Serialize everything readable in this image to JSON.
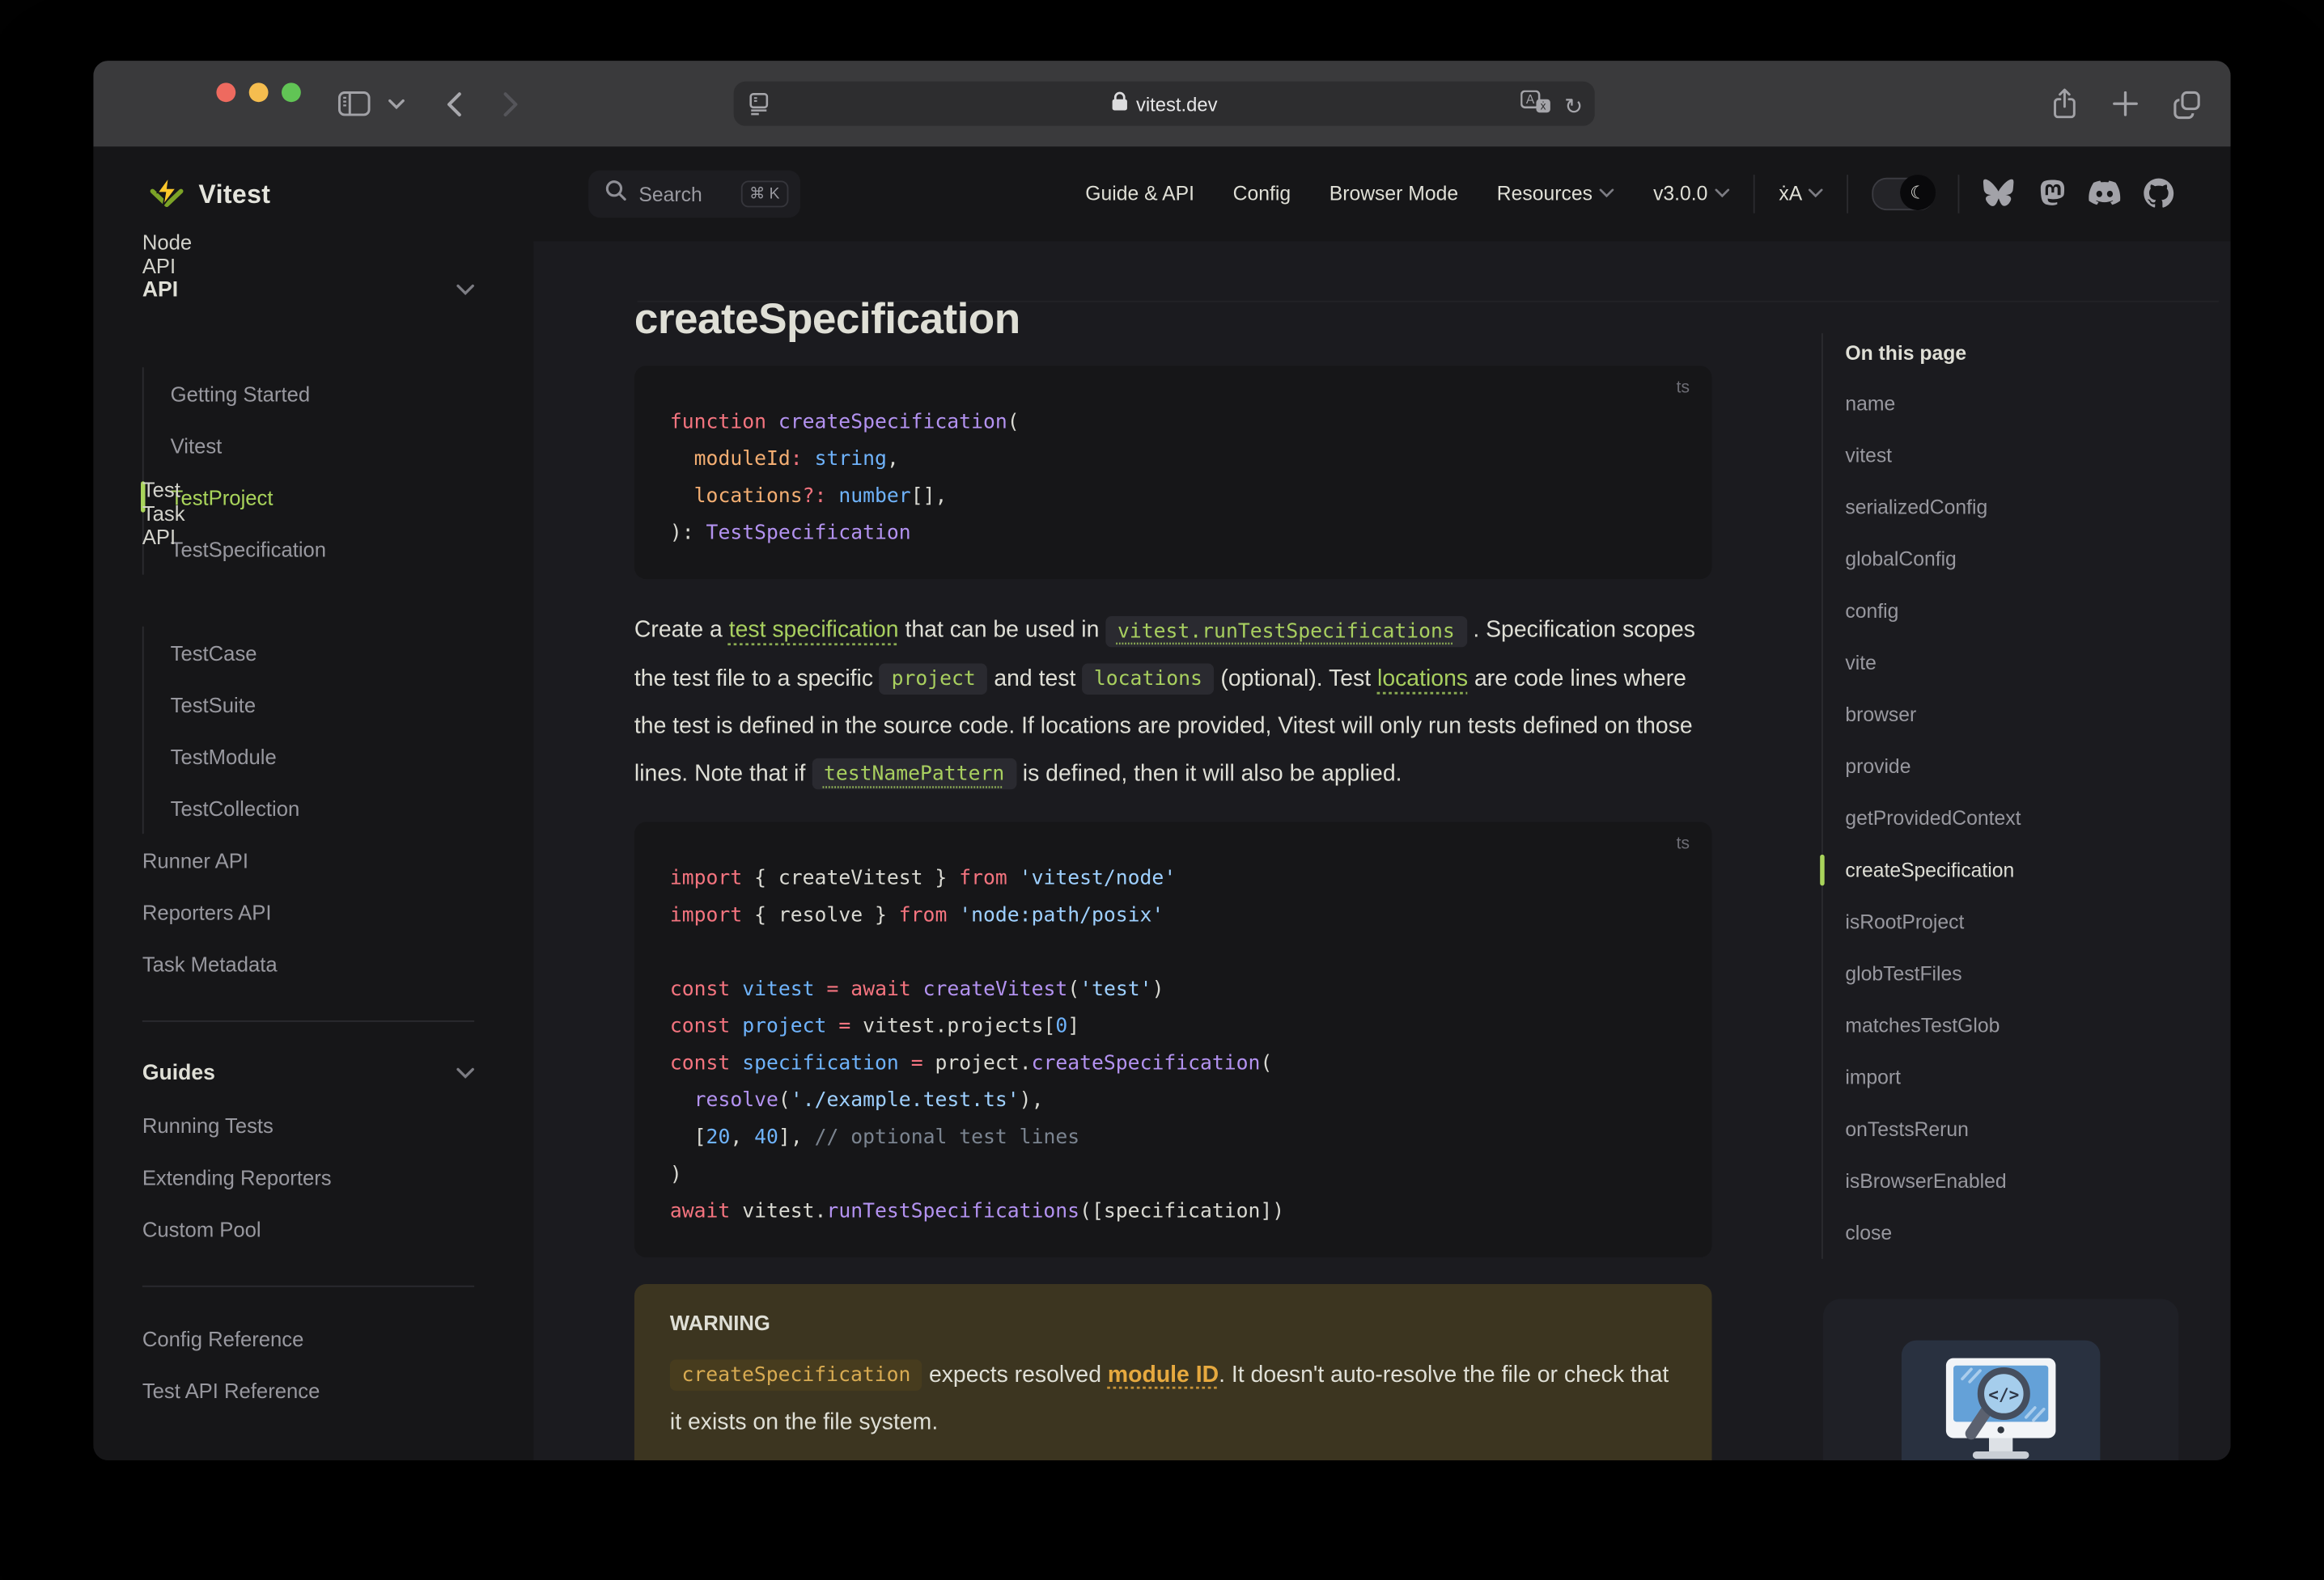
{
  "browser": {
    "url": "vitest.dev",
    "traffic_colors": [
      "#ee6a5f",
      "#f5bd4f",
      "#61c455"
    ]
  },
  "header": {
    "logo": "Vitest",
    "search_label": "Search",
    "search_kbd": "⌘ K",
    "menu": {
      "guide_api": "Guide & API",
      "config": "Config",
      "browser_mode": "Browser Mode",
      "resources": "Resources",
      "version": "v3.0.0",
      "translate": "ẋA",
      "theme_glyph": "☾"
    },
    "social_icons": [
      "bluesky-icon",
      "mastodon-icon",
      "discord-icon",
      "github-icon"
    ],
    "accent": "#a9d45b"
  },
  "sidebar": {
    "groups": [
      {
        "type": "heading",
        "label": "API"
      },
      {
        "type": "link",
        "label": "Node API",
        "tone": "light"
      },
      {
        "type": "sub",
        "items": [
          {
            "label": "Getting Started"
          },
          {
            "label": "Vitest"
          },
          {
            "label": "TestProject",
            "active": true
          },
          {
            "label": "TestSpecification"
          }
        ]
      },
      {
        "type": "link",
        "label": "Test Task API",
        "tone": "light"
      },
      {
        "type": "sub",
        "items": [
          {
            "label": "TestCase"
          },
          {
            "label": "TestSuite"
          },
          {
            "label": "TestModule"
          },
          {
            "label": "TestCollection"
          }
        ]
      },
      {
        "type": "link",
        "label": "Runner API"
      },
      {
        "type": "link",
        "label": "Reporters API"
      },
      {
        "type": "link",
        "label": "Task Metadata"
      },
      {
        "type": "divider"
      },
      {
        "type": "heading",
        "label": "Guides"
      },
      {
        "type": "link",
        "label": "Running Tests"
      },
      {
        "type": "link",
        "label": "Extending Reporters"
      },
      {
        "type": "link",
        "label": "Custom Pool"
      },
      {
        "type": "divider"
      },
      {
        "type": "link",
        "label": "Config Reference"
      },
      {
        "type": "link",
        "label": "Test API Reference"
      }
    ]
  },
  "page": {
    "title": "createSpecification",
    "code1": {
      "lang": "ts",
      "lines": [
        [
          {
            "t": "function ",
            "c": "k"
          },
          {
            "t": "createSpecification",
            "c": "f"
          },
          {
            "t": "("
          }
        ],
        [
          {
            "t": "  "
          },
          {
            "t": "moduleId",
            "c": "o"
          },
          {
            "t": ":",
            "c": "k"
          },
          {
            "t": " "
          },
          {
            "t": "string",
            "c": "v"
          },
          {
            "t": ","
          }
        ],
        [
          {
            "t": "  "
          },
          {
            "t": "locations",
            "c": "o"
          },
          {
            "t": "?:",
            "c": "k"
          },
          {
            "t": " "
          },
          {
            "t": "number",
            "c": "v"
          },
          {
            "t": "[],"
          }
        ],
        [
          {
            "t": "): "
          },
          {
            "t": "TestSpecification",
            "c": "f"
          }
        ]
      ]
    },
    "intro": [
      {
        "t": "Create a "
      },
      {
        "t": "test specification",
        "k": "link"
      },
      {
        "t": " that can be used in "
      },
      {
        "t": "vitest.runTestSpecifications",
        "k": "codelink"
      },
      {
        "t": " . Specification scopes the test file to a specific "
      },
      {
        "t": "project",
        "k": "code"
      },
      {
        "t": " and test "
      },
      {
        "t": "locations",
        "k": "code"
      },
      {
        "t": " (optional). Test "
      },
      {
        "t": "locations",
        "k": "link"
      },
      {
        "t": " are code lines where the test is defined in the source code. If locations are provided, Vitest will only run tests defined on those lines. Note that if "
      },
      {
        "t": "testNamePattern",
        "k": "codelink"
      },
      {
        "t": " is defined, then it will also be applied."
      }
    ],
    "code2": {
      "lang": "ts",
      "lines": [
        [
          {
            "t": "import",
            "c": "k"
          },
          {
            "t": " { createVitest } "
          },
          {
            "t": "from",
            "c": "k"
          },
          {
            "t": " "
          },
          {
            "t": "'vitest/node'",
            "c": "s"
          }
        ],
        [
          {
            "t": "import",
            "c": "k"
          },
          {
            "t": " { resolve } "
          },
          {
            "t": "from",
            "c": "k"
          },
          {
            "t": " "
          },
          {
            "t": "'node:path/posix'",
            "c": "s"
          }
        ],
        [
          {
            "t": " "
          }
        ],
        [
          {
            "t": "const",
            "c": "k"
          },
          {
            "t": " "
          },
          {
            "t": "vitest",
            "c": "v"
          },
          {
            "t": " "
          },
          {
            "t": "=",
            "c": "k"
          },
          {
            "t": " "
          },
          {
            "t": "await",
            "c": "k"
          },
          {
            "t": " "
          },
          {
            "t": "createVitest",
            "c": "f"
          },
          {
            "t": "("
          },
          {
            "t": "'test'",
            "c": "s"
          },
          {
            "t": ")"
          }
        ],
        [
          {
            "t": "const",
            "c": "k"
          },
          {
            "t": " "
          },
          {
            "t": "project",
            "c": "v"
          },
          {
            "t": " "
          },
          {
            "t": "=",
            "c": "k"
          },
          {
            "t": " vitest.projects["
          },
          {
            "t": "0",
            "c": "n"
          },
          {
            "t": "]"
          }
        ],
        [
          {
            "t": "const",
            "c": "k"
          },
          {
            "t": " "
          },
          {
            "t": "specification",
            "c": "v"
          },
          {
            "t": " "
          },
          {
            "t": "=",
            "c": "k"
          },
          {
            "t": " project."
          },
          {
            "t": "createSpecification",
            "c": "f"
          },
          {
            "t": "("
          }
        ],
        [
          {
            "t": "  "
          },
          {
            "t": "resolve",
            "c": "f"
          },
          {
            "t": "("
          },
          {
            "t": "'./example.test.ts'",
            "c": "s"
          },
          {
            "t": "),"
          }
        ],
        [
          {
            "t": "  ["
          },
          {
            "t": "20",
            "c": "n"
          },
          {
            "t": ", "
          },
          {
            "t": "40",
            "c": "n"
          },
          {
            "t": "], "
          },
          {
            "t": "// optional test lines",
            "c": "cm"
          }
        ],
        [
          {
            "t": ")"
          }
        ],
        [
          {
            "t": "await",
            "c": "k"
          },
          {
            "t": " vitest."
          },
          {
            "t": "runTestSpecifications",
            "c": "f"
          },
          {
            "t": "(["
          },
          {
            "t": "specification"
          },
          {
            "t": "])"
          }
        ]
      ]
    },
    "warning": {
      "title": "WARNING",
      "body": [
        {
          "t": "createSpecification",
          "k": "wcode"
        },
        {
          "t": " expects resolved "
        },
        {
          "t": "module ID",
          "k": "wlink"
        },
        {
          "t": ". It doesn't auto-resolve the file or check that it exists on the file system."
        }
      ]
    }
  },
  "toc": {
    "title": "On this page",
    "items": [
      "name",
      "vitest",
      "serializedConfig",
      "globalConfig",
      "config",
      "vite",
      "browser",
      "provide",
      "getProvidedContext",
      "createSpecification",
      "isRootProject",
      "globTestFiles",
      "matchesTestGlob",
      "import",
      "onTestsRerun",
      "isBrowserEnabled",
      "close"
    ],
    "active_index": 9
  }
}
